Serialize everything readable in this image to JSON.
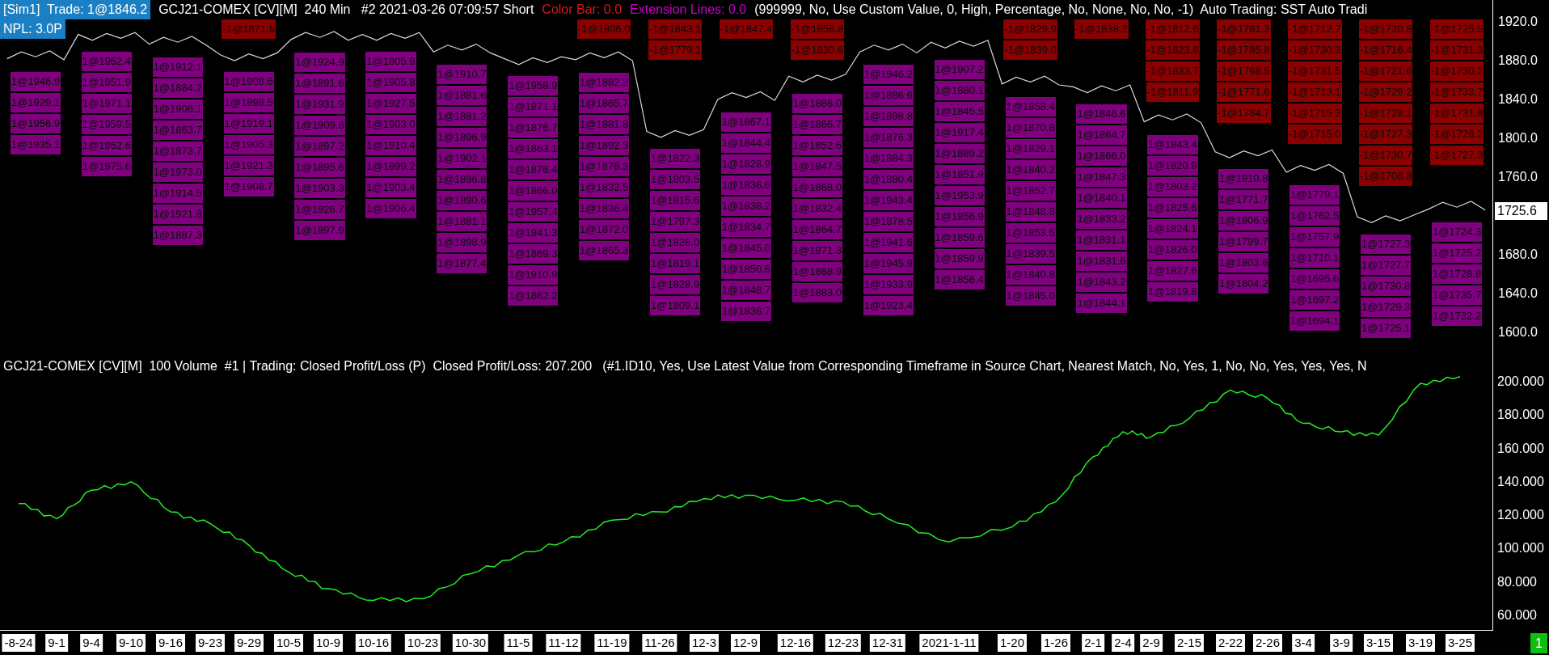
{
  "chart_header": {
    "trade_badge": "[Sim1]  Trade: 1@1846.2",
    "npl_badge": "NPL: 3.0P",
    "items": [
      {
        "text": "GCJ21-COMEX [CV][M]  240 Min   #2 2021-03-26 07:09:57 Short",
        "color": "#ffffff"
      },
      {
        "text": "Color Bar: 0.0",
        "color": "#d81818"
      },
      {
        "text": "Extension Lines: 0.0",
        "color": "#cc00cc"
      },
      {
        "text": "(999999, No, Use Custom Value, 0, High, Percentage, No, None, No, No, -1)  Auto Trading: SST Auto Tradi",
        "color": "#ffffff"
      }
    ]
  },
  "trade_labels": {
    "columns": [
      {
        "buys": [
          "1@1946.9",
          "1@1929.1",
          "1@1956.9",
          "1@1935.1"
        ]
      },
      {
        "buys": [
          "1@1962.4",
          "1@1951.9",
          "1@1971.1",
          "1@1959.5",
          "1@1962.6",
          "1@1975.6"
        ]
      },
      {
        "buys": [
          "1@1912.1",
          "1@1884.2",
          "1@1906.1",
          "1@1863.7",
          "1@1873.7",
          "1@1973.0",
          "1@1914.5",
          "1@1921.8",
          "1@1887.3"
        ]
      },
      {
        "sells": [
          "-1@1871.6"
        ],
        "buys": [
          "1@1908.6",
          "1@1898.5",
          "1@1919.1",
          "1@1905.3",
          "1@1921.3",
          "1@1908.7"
        ]
      },
      {
        "buys": [
          "1@1924.9",
          "1@1891.6",
          "1@1931.9",
          "1@1909.8",
          "1@1897.2",
          "1@1895.6",
          "1@1903.3",
          "1@1926.7",
          "1@1897.9"
        ]
      },
      {
        "buys": [
          "1@1905.9",
          "1@1905.8",
          "1@1927.5",
          "1@1903.0",
          "1@1910.4",
          "1@1899.2",
          "1@1903.4",
          "1@1906.4"
        ]
      },
      {
        "buys": [
          "1@1910.7",
          "1@1881.6",
          "1@1881.2",
          "1@1896.9",
          "1@1902.1",
          "1@1896.8",
          "1@1890.6",
          "1@1881.1",
          "1@1898.9",
          "1@1877.4"
        ]
      },
      {
        "buys": [
          "1@1958.9",
          "1@1871.1",
          "1@1876.7",
          "1@1863.1",
          "1@1876.4",
          "1@1866.0",
          "1@1957.4",
          "1@1941.3",
          "1@1869.3",
          "1@1910.9",
          "1@1862.2"
        ]
      },
      {
        "sells": [
          "-1@1806.0"
        ],
        "buys": [
          "1@1882.2",
          "1@1865.7",
          "1@1881.8",
          "1@1892.3",
          "1@1878.3",
          "1@1832.5",
          "1@1836.4",
          "1@1872.0",
          "1@1865.3"
        ]
      },
      {
        "sells": [
          "-1@1843.1",
          "-1@1779.1"
        ],
        "buys": [
          "1@1822.3",
          "1@1803.5",
          "1@1815.6",
          "1@1797.3",
          "1@1826.0",
          "1@1819.1",
          "1@1828.9",
          "1@1809.1"
        ]
      },
      {
        "sells": [
          "-1@1847.4"
        ],
        "buys": [
          "1@1867.1",
          "1@1844.4",
          "1@1828.9",
          "1@1836.6",
          "1@1838.2",
          "1@1834.7",
          "1@1845.0",
          "1@1850.6",
          "1@1848.7",
          "1@1836.7"
        ]
      },
      {
        "sells": [
          "-1@1858.8",
          "-1@1830.6"
        ],
        "buys": [
          "1@1886.0",
          "1@1866.7",
          "1@1852.6",
          "1@1847.5",
          "1@1868.0",
          "1@1832.4",
          "1@1864.7",
          "1@1871.3",
          "1@1868.9",
          "1@1883.0"
        ]
      },
      {
        "buys": [
          "1@1946.2",
          "1@1886.6",
          "1@1898.8",
          "1@1876.3",
          "1@1884.3",
          "1@1880.4",
          "1@1943.4",
          "1@1878.5",
          "1@1941.6",
          "1@1945.9",
          "1@1933.9",
          "1@1923.4"
        ]
      },
      {
        "buys": [
          "1@1907.2",
          "1@1880.1",
          "1@1845.5",
          "1@1917.4",
          "1@1889.2",
          "1@1851.9",
          "1@1953.9",
          "1@1856.9",
          "1@1859.6",
          "1@1859.9",
          "1@1856.4"
        ]
      },
      {
        "sells": [
          "-1@1829.9",
          "-1@1839.0"
        ],
        "buys": [
          "1@1858.4",
          "1@1870.8",
          "1@1829.1",
          "1@1840.2",
          "1@1852.7",
          "1@1848.8",
          "1@1853.5",
          "1@1839.5",
          "1@1840.8",
          "1@1845.0"
        ]
      },
      {
        "sells": [
          "-1@1838.2"
        ],
        "buys": [
          "1@1846.6",
          "1@1864.7",
          "1@1866.0",
          "1@1847.3",
          "1@1840.1",
          "1@1833.2",
          "1@1831.1",
          "1@1831.6",
          "1@1843.2",
          "1@1844.1"
        ]
      },
      {
        "sells": [
          "-1@1812.6",
          "-1@1823.6",
          "-1@1833.7",
          "-1@1811.9"
        ],
        "buys": [
          "1@1843.4",
          "1@1820.9",
          "1@1803.2",
          "1@1825.6",
          "1@1824.1",
          "1@1826.0",
          "1@1827.6",
          "1@1819.8"
        ]
      },
      {
        "sells": [
          "-1@1781.3",
          "-1@1785.8",
          "-1@1768.5",
          "-1@1771.6",
          "-1@1784.7"
        ],
        "buys": [
          "1@1810.8",
          "1@1771.7",
          "1@1806.9",
          "1@1799.7",
          "1@1803.6",
          "1@1804.2"
        ]
      },
      {
        "sells": [
          "-1@1712.7",
          "-1@1730.3",
          "-1@1731.5",
          "-1@1713.1",
          "-1@1715.3",
          "-1@1715.0"
        ],
        "buys": [
          "1@1779.1",
          "1@1762.5",
          "1@1757.9",
          "1@1710.1",
          "1@1695.6",
          "1@1697.2",
          "1@1694.1"
        ]
      },
      {
        "sells": [
          "-1@1720.8",
          "-1@1716.4",
          "-1@1721.6",
          "-1@1729.2",
          "-1@1728.1",
          "-1@1727.3",
          "-1@1730.7",
          "-1@1708.8"
        ],
        "buys": [
          "1@1727.3",
          "1@1727.7",
          "1@1730.8",
          "1@1729.3",
          "1@1725.1"
        ]
      },
      {
        "sells": [
          "-1@1725.5",
          "-1@1731.3",
          "-1@1730.2",
          "-1@1733.7",
          "-1@1731.8",
          "-1@1728.2",
          "-1@1727.3"
        ],
        "buys": [
          "1@1724.3",
          "1@1725.2",
          "1@1728.8",
          "1@1735.7",
          "1@1732.2"
        ]
      }
    ]
  },
  "price_chart": {
    "chart_data": {
      "type": "line",
      "series": [
        {
          "color": "#d9d9d9",
          "values": [
            1882,
            1889,
            1884,
            1890,
            1881,
            1907,
            1901,
            1908,
            1903,
            1909,
            1897,
            1904,
            1899,
            1905,
            1896,
            1886,
            1880,
            1887,
            1882,
            1888,
            1902,
            1909,
            1904,
            1910,
            1901,
            1907,
            1901,
            1908,
            1903,
            1909,
            1889,
            1896,
            1891,
            1897,
            1888,
            1882,
            1876,
            1883,
            1878,
            1884,
            1881,
            1888,
            1883,
            1889,
            1880,
            1807,
            1801,
            1808,
            1803,
            1809,
            1840,
            1847,
            1842,
            1848,
            1839,
            1864,
            1858,
            1865,
            1860,
            1866,
            1889,
            1896,
            1891,
            1897,
            1888,
            1899,
            1893,
            1900,
            1895,
            1901,
            1856,
            1863,
            1858,
            1864,
            1855,
            1853,
            1847,
            1854,
            1849,
            1855,
            1817,
            1824,
            1819,
            1825,
            1816,
            1786,
            1780,
            1787,
            1782,
            1788,
            1765,
            1772,
            1767,
            1773,
            1764,
            1719,
            1713,
            1720,
            1715,
            1721,
            1727,
            1734,
            1729,
            1735,
            1726
          ]
        }
      ],
      "ylim": [
        1575.8,
        1942.5
      ],
      "yticks": [
        {
          "value": 1920,
          "label": "1920.0"
        },
        {
          "value": 1880,
          "label": "1880.0"
        },
        {
          "value": 1840,
          "label": "1840.0"
        },
        {
          "value": 1800,
          "label": "1800.0"
        },
        {
          "value": 1760,
          "label": "1760.0"
        },
        {
          "value": 1680,
          "label": "1680.0"
        },
        {
          "value": 1640,
          "label": "1640.0"
        },
        {
          "value": 1600,
          "label": "1600.0"
        }
      ]
    },
    "last_price": "1725.6"
  },
  "pl_panel": {
    "header": "GCJ21-COMEX [CV][M]  100 Volume  #1 | Trading: Closed Profit/Loss (P)  Closed Profit/Loss: 207.200   (#1.ID10, Yes, Use Latest Value from Corresponding Timeframe in Source Chart, Nearest Match, No, Yes, 1, No, No, Yes, Yes, Yes, N",
    "chart_data": {
      "type": "line",
      "categories": [
        "-8-24",
        "9-1",
        "9-4",
        "9-10",
        "9-16",
        "9-23",
        "9-29",
        "10-5",
        "10-9",
        "10-16",
        "10-23",
        "10-30",
        "11-5",
        "11-12",
        "11-19",
        "11-26",
        "12-3",
        "12-9",
        "12-16",
        "12-23",
        "12-31",
        "2021-1-11",
        "1-20",
        "1-26",
        "2-1",
        "2-4",
        "2-9",
        "2-15",
        "2-22",
        "2-26",
        "3-4",
        "3-9",
        "3-15",
        "3-19",
        "3-25"
      ],
      "series": [
        {
          "color": "#22ee22",
          "values": [
            127,
            118,
            135,
            140,
            122,
            115,
            102,
            86,
            76,
            69,
            70,
            85,
            96,
            104,
            117,
            122,
            130,
            132,
            129,
            128,
            118,
            104,
            113,
            128,
            155,
            170,
            167,
            178,
            195,
            190,
            175,
            170,
            168,
            199,
            203
          ]
        }
      ],
      "ylim": [
        50.8,
        215.5
      ],
      "yticks": [
        {
          "value": 200,
          "label": "200.000"
        },
        {
          "value": 180,
          "label": "180.000"
        },
        {
          "value": 160,
          "label": "160.000"
        },
        {
          "value": 140,
          "label": "140.000"
        },
        {
          "value": 120,
          "label": "120.000"
        },
        {
          "value": 100,
          "label": "100.000"
        },
        {
          "value": 80,
          "label": "80.000"
        },
        {
          "value": 60,
          "label": "60.000"
        }
      ]
    }
  },
  "corner_badge": "1"
}
